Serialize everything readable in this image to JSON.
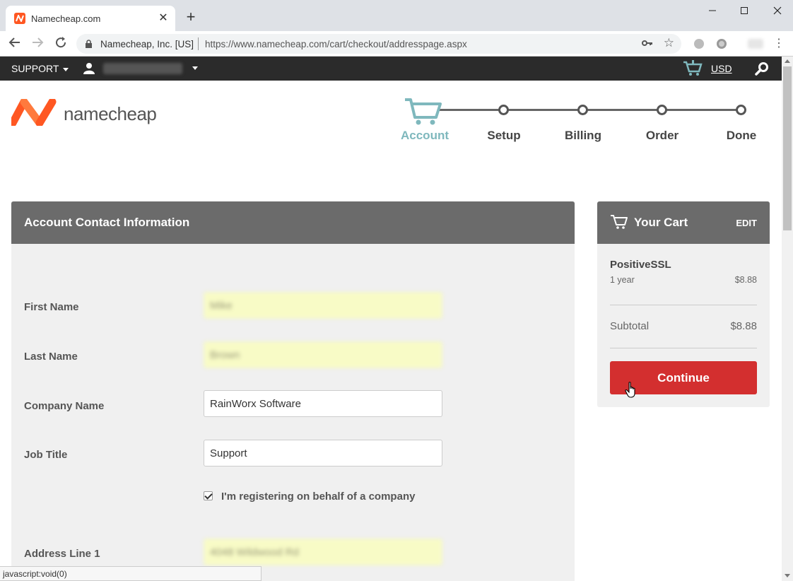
{
  "browser": {
    "tab_title": "Namecheap.com",
    "tab_close": "✕",
    "new_tab": "+",
    "site_identity": "Namecheap, Inc. [US]",
    "url": "https://www.namecheap.com/cart/checkout/addresspage.aspx",
    "status_url": "javascript:void(0)"
  },
  "topbar": {
    "support_label": "SUPPORT",
    "currency": "USD"
  },
  "logo": {
    "text": "namecheap",
    "accent": "#ff5722"
  },
  "steps": [
    {
      "label": "Account",
      "active": true
    },
    {
      "label": "Setup",
      "active": false
    },
    {
      "label": "Billing",
      "active": false
    },
    {
      "label": "Order",
      "active": false
    },
    {
      "label": "Done",
      "active": false
    }
  ],
  "form": {
    "title": "Account Contact Information",
    "fields": [
      {
        "label": "First Name",
        "value": "Mike",
        "autofill": true
      },
      {
        "label": "Last Name",
        "value": "Brown",
        "autofill": true
      },
      {
        "label": "Company Name",
        "value": "RainWorx Software",
        "autofill": false
      },
      {
        "label": "Job Title",
        "value": "Support",
        "autofill": false
      },
      {
        "label": "Address Line 1",
        "value": "4048 Wildwood Rd",
        "autofill": true
      }
    ],
    "company_checkbox_label": "I'm registering on behalf of a company",
    "company_checkbox_checked": true
  },
  "cart": {
    "title": "Your Cart",
    "edit_label": "EDIT",
    "item_name": "PositiveSSL",
    "item_term": "1 year",
    "item_price": "$8.88",
    "subtotal_label": "Subtotal",
    "subtotal_value": "$8.88",
    "continue_label": "Continue"
  },
  "colors": {
    "primary_button": "#d32f2f",
    "active_step": "#7fb8bd",
    "panel_header": "#6b6b6b"
  }
}
